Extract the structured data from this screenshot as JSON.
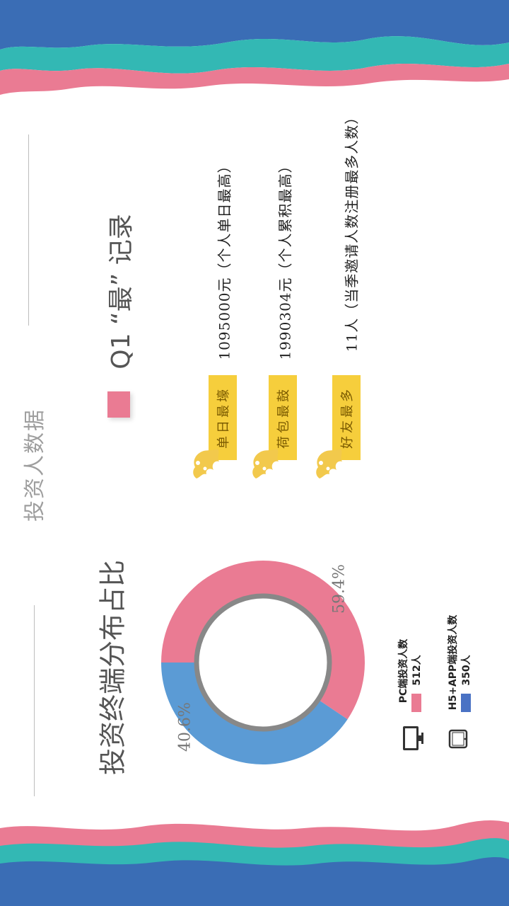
{
  "section_title": "投资人数据",
  "q1": {
    "title": "Q1 “最” 记录",
    "records": [
      {
        "tag": "单日最壕",
        "text": "1095000元（个人单日最高）"
      },
      {
        "tag": "荷包最鼓",
        "text": "1990304元（个人累积最高）"
      },
      {
        "tag": "好友最多",
        "text": "11人（当季邀请人数注册最多人数）"
      }
    ]
  },
  "chart_title": "投资终端分布占比",
  "chart_data": {
    "type": "pie",
    "labels": [
      "PC端投资人数",
      "H5+APP端投资人数"
    ],
    "values": [
      59.4,
      40.6
    ],
    "data_labels": [
      "59.4%",
      "40.6%"
    ],
    "counts": [
      "512人",
      "350人"
    ],
    "colors": [
      "#ea7b93",
      "#5b9bd5"
    ]
  },
  "legend": [
    {
      "name": "PC端投资人数",
      "count": "512人",
      "color": "#ea7b93",
      "icon": "monitor-icon"
    },
    {
      "name": "H5+APP端投资人数",
      "count": "350人",
      "color": "#4a72c4",
      "icon": "tablet-icon"
    }
  ],
  "colors": {
    "pink": "#ea7b93",
    "teal": "#33b8b4",
    "blue": "#3a6db5",
    "yellow": "#f6ce3c",
    "grey_text": "#9e9e9e"
  }
}
